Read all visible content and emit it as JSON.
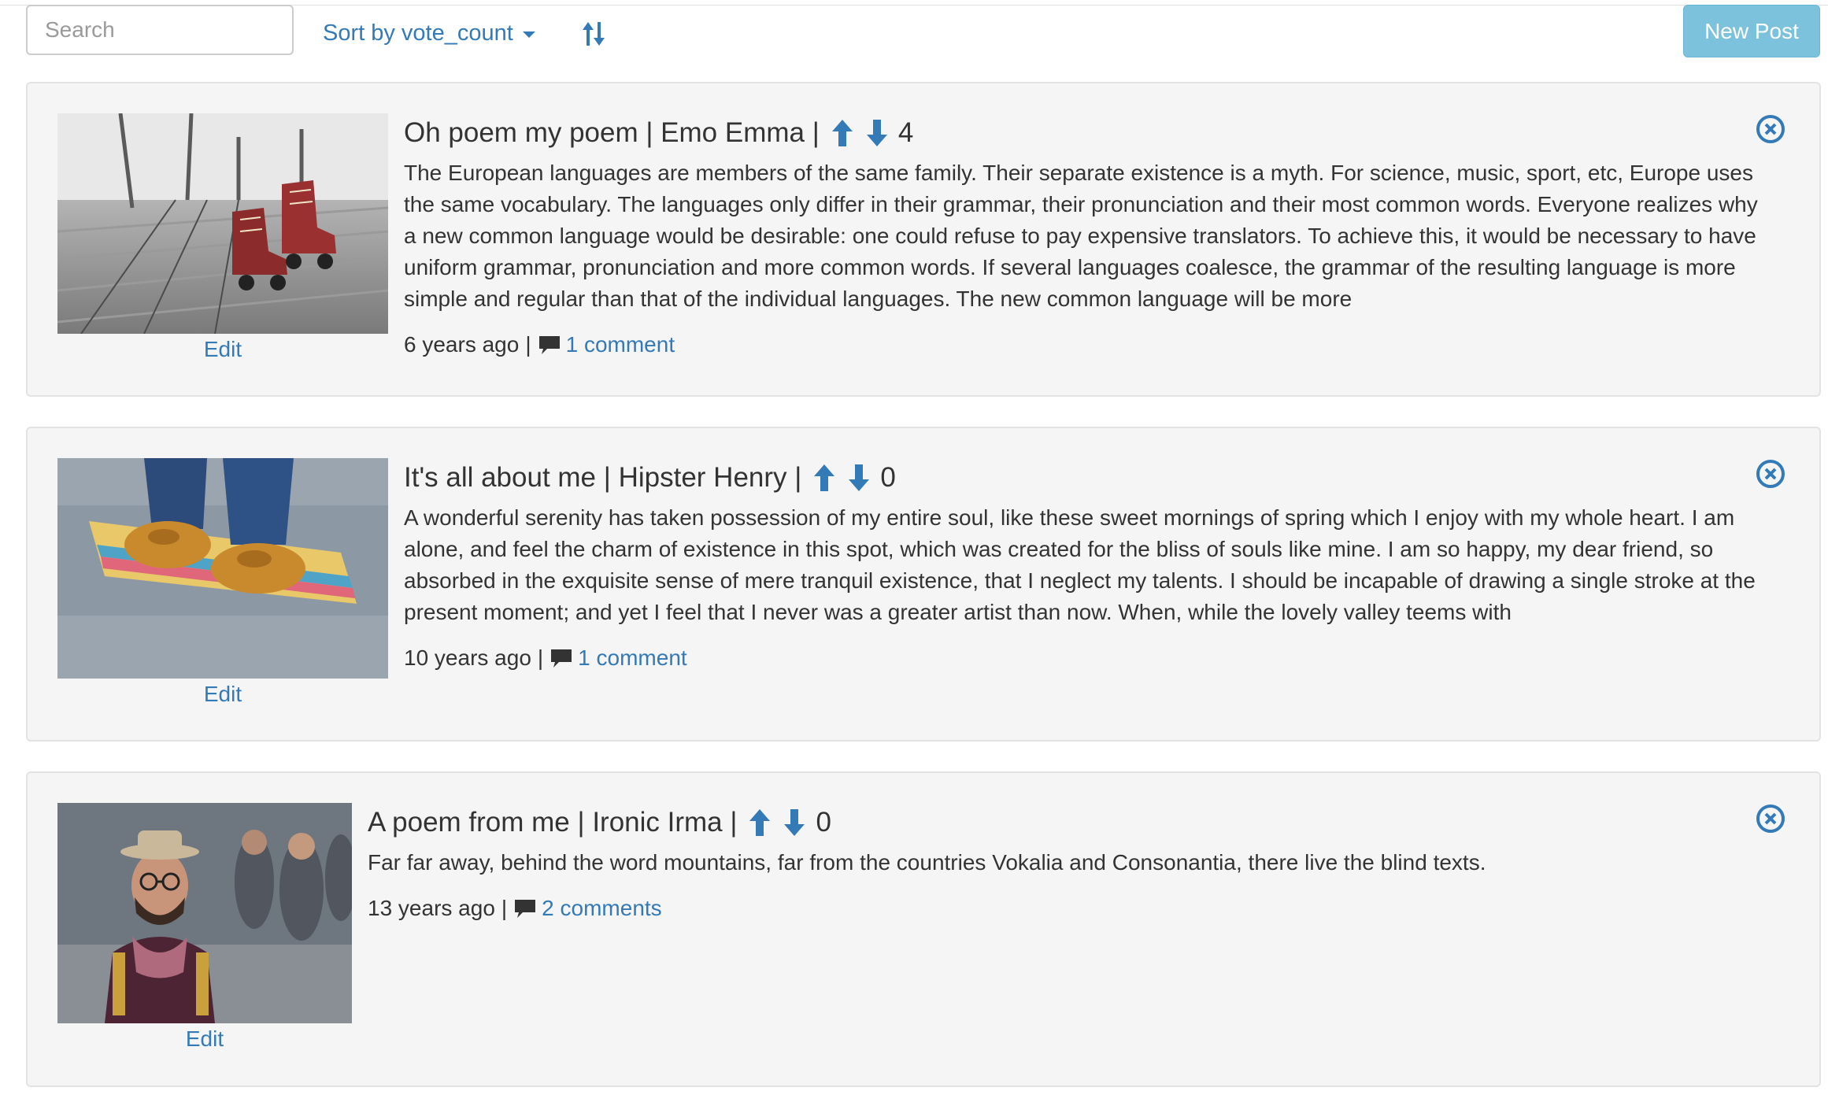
{
  "toolbar": {
    "search_placeholder": "Search",
    "sort_label": "Sort by vote_count",
    "sort_direction_icon": "sort-arrows-icon",
    "new_post_label": "New Post"
  },
  "colors": {
    "link": "#337ab7",
    "panel_bg": "#f5f5f5",
    "panel_border": "#e3e3e3",
    "button_info": "#7cc2dd",
    "text": "#333333"
  },
  "posts": [
    {
      "title": "Oh poem my poem",
      "author": "Emo Emma",
      "votes": "4",
      "body": "The European languages are members of the same family. Their separate existence is a myth. For science, music, sport, etc, Europe uses the same vocabulary. The languages only differ in their grammar, their pronunciation and their most common words. Everyone realizes why a new common language would be desirable: one could refuse to pay expensive translators. To achieve this, it would be necessary to have uniform grammar, pronunciation and more common words. If several languages coalesce, the grammar of the resulting language is more simple and regular than that of the individual languages. The new common language will be more",
      "age": "6 years ago",
      "comments": "1 comment",
      "edit_label": "Edit",
      "image": "roller-skates-photo"
    },
    {
      "title": "It's all about me",
      "author": "Hipster Henry",
      "votes": "0",
      "body": "A wonderful serenity has taken possession of my entire soul, like these sweet mornings of spring which I enjoy with my whole heart. I am alone, and feel the charm of existence in this spot, which was created for the bliss of souls like mine. I am so happy, my dear friend, so absorbed in the exquisite sense of mere tranquil existence, that I neglect my talents. I should be incapable of drawing a single stroke at the present moment; and yet I feel that I never was a greater artist than now. When, while the lovely valley teems with",
      "age": "10 years ago",
      "comments": "1 comment",
      "edit_label": "Edit",
      "image": "skateboard-shoes-photo"
    },
    {
      "title": "A poem from me",
      "author": "Ironic Irma",
      "votes": "0",
      "body": "Far far away, behind the word mountains, far from the countries Vokalia and Consonantia, there live the blind texts.",
      "age": "13 years ago",
      "comments": "2 comments",
      "edit_label": "Edit",
      "image": "hipster-portrait-photo"
    }
  ]
}
